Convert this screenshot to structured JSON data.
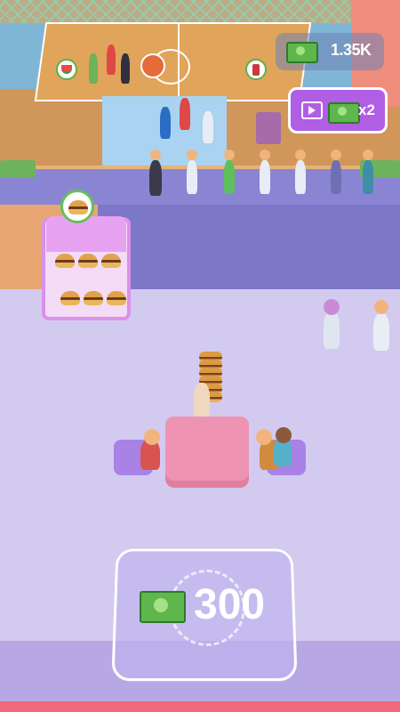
{
  "hud": {
    "money": "1.35K",
    "money_icon": "cash-icon",
    "boost_label": "x2",
    "boost_icon": "video-icon",
    "accent": "#b05ee3"
  },
  "cash_zone": {
    "amount": "300",
    "icon": "cash-icon"
  },
  "shelf": {
    "product_icon": "burger-icon"
  },
  "colors": {
    "floor": "#d3caf0",
    "corridor": "#7c78c7",
    "table": "#ee94b2",
    "chair": "#a982e6"
  }
}
